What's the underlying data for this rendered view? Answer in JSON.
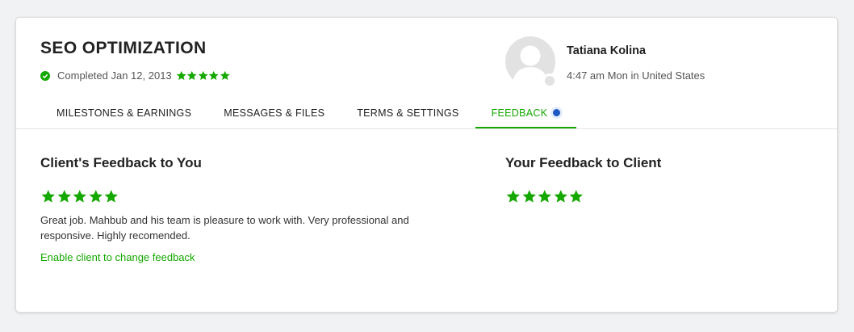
{
  "contract": {
    "title": "SEO OPTIMIZATION",
    "status": "Completed Jan 12, 2013",
    "rating": 5
  },
  "client": {
    "name": "Tatiana Kolina",
    "local_time": "4:47 am Mon in United States"
  },
  "tabs": [
    {
      "label": "MILESTONES & EARNINGS",
      "active": false
    },
    {
      "label": "MESSAGES & FILES",
      "active": false
    },
    {
      "label": "TERMS & SETTINGS",
      "active": false
    },
    {
      "label": "FEEDBACK",
      "active": true,
      "has_notification": true
    }
  ],
  "client_feedback": {
    "heading": "Client's Feedback to You",
    "rating": 5,
    "comment": "Great job. Mahbub and his team is pleasure to work with. Very professional and responsive. Highly recomended.",
    "link_label": "Enable client to change feedback"
  },
  "your_feedback": {
    "heading": "Your Feedback to Client",
    "rating": 5
  },
  "colors": {
    "accent": "#14a800",
    "notification": "#1f57c3",
    "avatar_placeholder": "#e2e2e2"
  },
  "icons": {
    "status": "check-circle-icon",
    "rating": "star-icon",
    "avatar": "user-silhouette-icon",
    "notification": "dot-icon"
  }
}
